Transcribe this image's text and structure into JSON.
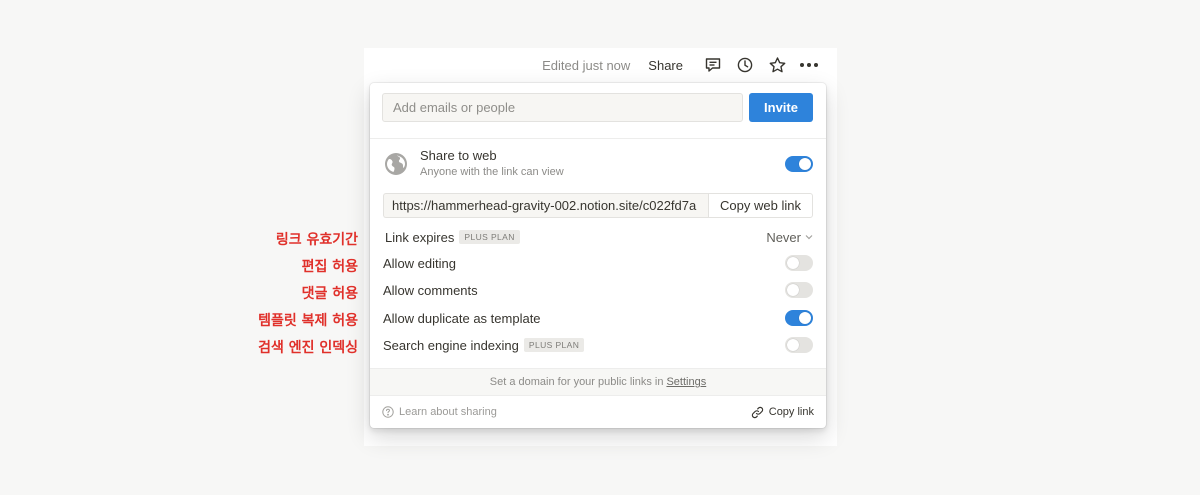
{
  "topbar": {
    "edited_text": "Edited just now",
    "share_label": "Share",
    "icons": [
      "comment-icon",
      "history-icon",
      "star-icon",
      "more-icon"
    ]
  },
  "dialog": {
    "email_placeholder": "Add emails or people",
    "invite_label": "Invite",
    "share_to_web": {
      "title": "Share to web",
      "subtitle": "Anyone with the link can view",
      "enabled": true
    },
    "url": "https://hammerhead-gravity-002.notion.site/c022fd7a",
    "copy_web_link_label": "Copy web link",
    "options": {
      "link_expires": {
        "label": "Link expires",
        "badge": "PLUS PLAN",
        "value": "Never"
      },
      "allow_editing": {
        "label": "Allow editing",
        "enabled": false
      },
      "allow_comments": {
        "label": "Allow comments",
        "enabled": false
      },
      "allow_duplicate": {
        "label": "Allow duplicate as template",
        "enabled": true
      },
      "search_indexing": {
        "label": "Search engine indexing",
        "badge": "PLUS PLAN",
        "enabled": false
      }
    },
    "domain_note": "Set a domain for your public links in",
    "settings_link": "Settings",
    "learn_label": "Learn about sharing",
    "copy_link_label": "Copy link"
  },
  "annotations": {
    "link_expiry": "링크 유효기간",
    "allow_editing": "편집 허용",
    "allow_comments": "댓글 허용",
    "allow_duplicate": "템플릿 복제 허용",
    "search_indexing": "검색 엔진 인덱싱"
  },
  "colors": {
    "accent": "#2e83db",
    "annotation": "#e0302a"
  }
}
